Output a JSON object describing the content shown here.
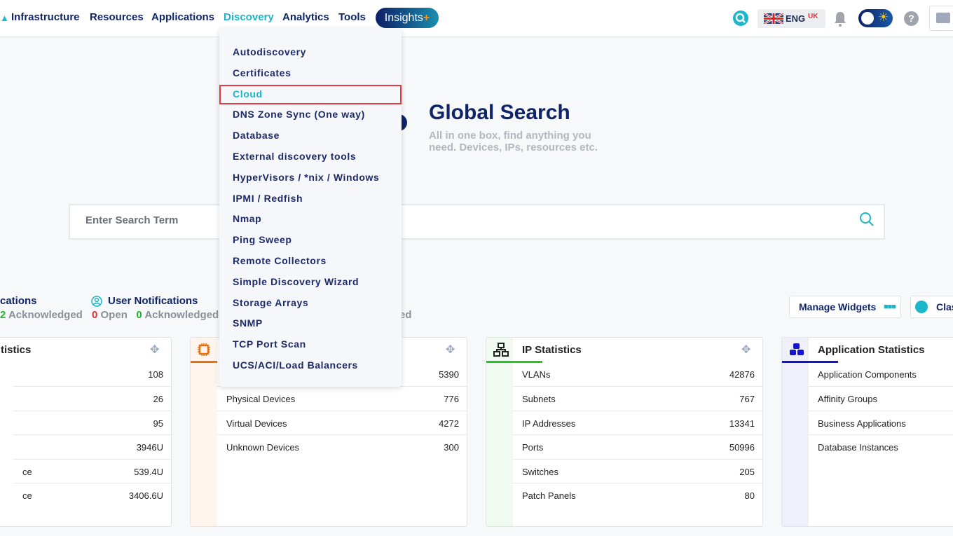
{
  "nav": {
    "items": [
      "Infrastructure",
      "Resources",
      "Applications",
      "Discovery",
      "Analytics",
      "Tools"
    ],
    "active": "Discovery",
    "insights": "Insights",
    "insights_plus": "+",
    "lang": "ENG",
    "lang_region": "UK",
    "help": "?"
  },
  "colors": {
    "accent": "#1ab6c9",
    "navy": "#0f2567",
    "highlight": "#e63946"
  },
  "global_search": {
    "title": "Global Search",
    "subtitle": "All in one box, find anything you need. Devices, IPs, resources etc.",
    "placeholder": "Enter Search Term"
  },
  "notifications": [
    {
      "title": "cations",
      "ack_count": "2",
      "ack_label": "Acknowledged"
    },
    {
      "title": "User Notifications",
      "open_count": "0",
      "open_label": "Open",
      "ack_count": "0",
      "ack_label": "Acknowledged"
    },
    {
      "tail": "ed"
    }
  ],
  "buttons": {
    "manage_widgets": "Manage Widgets",
    "classic": "Clas"
  },
  "cards": [
    {
      "title": "tistics",
      "rows": [
        {
          "l": "",
          "v": "108"
        },
        {
          "l": "",
          "v": "26"
        },
        {
          "l": "",
          "v": "95"
        },
        {
          "l": "",
          "v": "3946U"
        },
        {
          "l": "ce",
          "v": "539.4U"
        },
        {
          "l": "ce",
          "v": "3406.6U"
        }
      ]
    },
    {
      "title": "",
      "rows": [
        {
          "l": "",
          "v": "5390"
        },
        {
          "l": "Physical Devices",
          "v": "776"
        },
        {
          "l": "Virtual Devices",
          "v": "4272"
        },
        {
          "l": "Unknown Devices",
          "v": "300"
        }
      ]
    },
    {
      "title": "IP Statistics",
      "rows": [
        {
          "l": "VLANs",
          "v": "42876"
        },
        {
          "l": "Subnets",
          "v": "767"
        },
        {
          "l": "IP Addresses",
          "v": "13341"
        },
        {
          "l": "Ports",
          "v": "50996"
        },
        {
          "l": "Switches",
          "v": "205"
        },
        {
          "l": "Patch Panels",
          "v": "80"
        }
      ]
    },
    {
      "title": "Application Statistics",
      "rows": [
        {
          "l": "Application Components",
          "v": ""
        },
        {
          "l": "Affinity Groups",
          "v": ""
        },
        {
          "l": "Business Applications",
          "v": ""
        },
        {
          "l": "Database Instances",
          "v": ""
        }
      ]
    }
  ],
  "discovery_menu": {
    "items": [
      "Autodiscovery",
      "Certificates",
      "Cloud",
      "DNS Zone Sync (One way)",
      "Database",
      "External discovery tools",
      "HyperVisors / *nix / Windows",
      "IPMI / Redfish",
      "Nmap",
      "Ping Sweep",
      "Remote Collectors",
      "Simple Discovery Wizard",
      "Storage Arrays",
      "SNMP",
      "TCP Port Scan",
      "UCS/ACI/Load Balancers"
    ],
    "selected": "Cloud"
  }
}
